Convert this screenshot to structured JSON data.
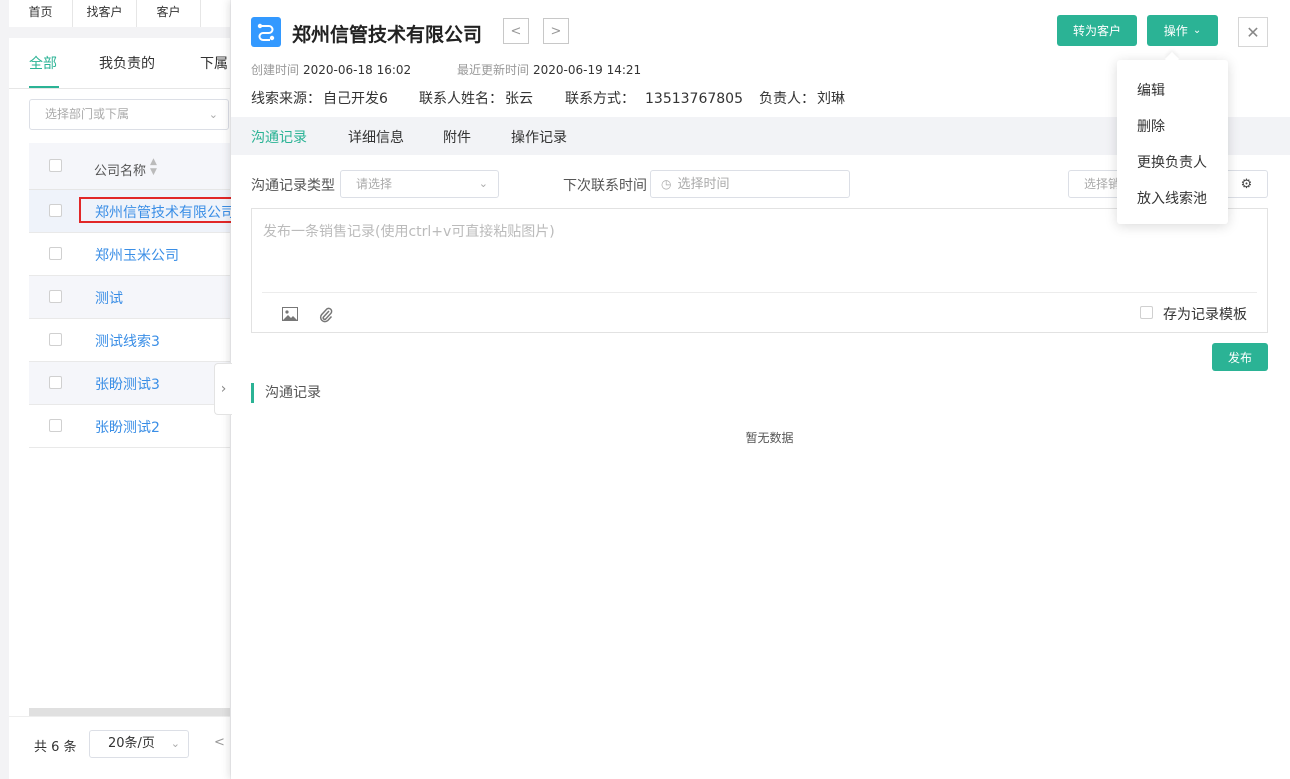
{
  "top_nav": [
    "首页",
    "找客户",
    "客户"
  ],
  "list": {
    "tabs": [
      "全部",
      "我负责的",
      "下属"
    ],
    "dept_select_placeholder": "选择部门或下属",
    "column_header": "公司名称",
    "rows": [
      "郑州信管技术有限公司",
      "郑州玉米公司",
      "测试",
      "测试线索3",
      "张盼测试3",
      "张盼测试2"
    ],
    "total": "共 6 条",
    "page_size": "20条/页"
  },
  "drawer": {
    "title": "郑州信管技术有限公司",
    "convert_button": "转为客户",
    "actions_button": "操作",
    "created_label": "创建时间",
    "created_value": "2020-06-18 16:02",
    "updated_label": "最近更新时间",
    "updated_value": "2020-06-19 14:21",
    "source_label": "线索来源：",
    "source_value": "自己开发6",
    "contact_name_label": "联系人姓名：",
    "contact_name_value": "张云",
    "contact_method_label": "联系方式：",
    "contact_method_value": "13513767805",
    "owner_label": "负责人：",
    "owner_value": "刘琳",
    "tabs": [
      "沟通记录",
      "详细信息",
      "附件",
      "操作记录"
    ],
    "record_type_label": "沟通记录类型",
    "record_type_placeholder": "请选择",
    "next_contact_label": "下次联系时间",
    "next_contact_placeholder": "选择时间",
    "template_select_placeholder": "选择销",
    "composer_placeholder": "发布一条销售记录(使用ctrl+v可直接粘贴图片)",
    "save_template_label": "存为记录模板",
    "publish_button": "发布",
    "records_section_title": "沟通记录",
    "empty_text": "暂无数据"
  },
  "dropdown_menu": [
    "编辑",
    "删除",
    "更换负责人",
    "放入线索池"
  ],
  "colors": {
    "accent": "#2bb395",
    "link": "#3a8ee6",
    "logo": "#3399ff",
    "highlight_box": "#e12828"
  }
}
